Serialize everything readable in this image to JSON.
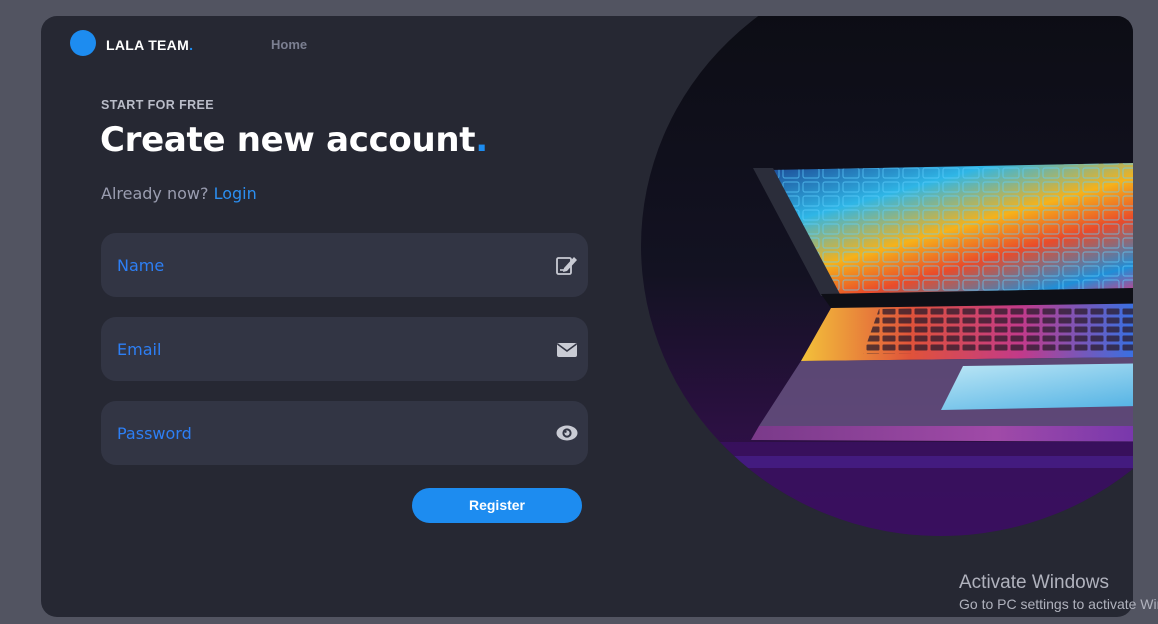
{
  "header": {
    "brand_name": "LALA TEAM",
    "brand_dot": ".",
    "nav_home": "Home"
  },
  "form": {
    "eyebrow": "START FOR FREE",
    "title": "Create new account",
    "title_dot": ".",
    "already_text": "Already now?",
    "login_link": "Login",
    "fields": [
      {
        "label": "Name",
        "icon": "edit-icon"
      },
      {
        "label": "Email",
        "icon": "envelope-icon"
      },
      {
        "label": "Password",
        "icon": "eye-icon"
      }
    ],
    "register_label": "Register"
  },
  "watermark": {
    "line1": "Activate Windows",
    "line2": "Go to PC settings to activate Windows."
  },
  "colors": {
    "accent": "#1d8cf0",
    "background": "#525461",
    "card": "#262833",
    "field": "#323544",
    "field_label": "#2d7ff5"
  }
}
